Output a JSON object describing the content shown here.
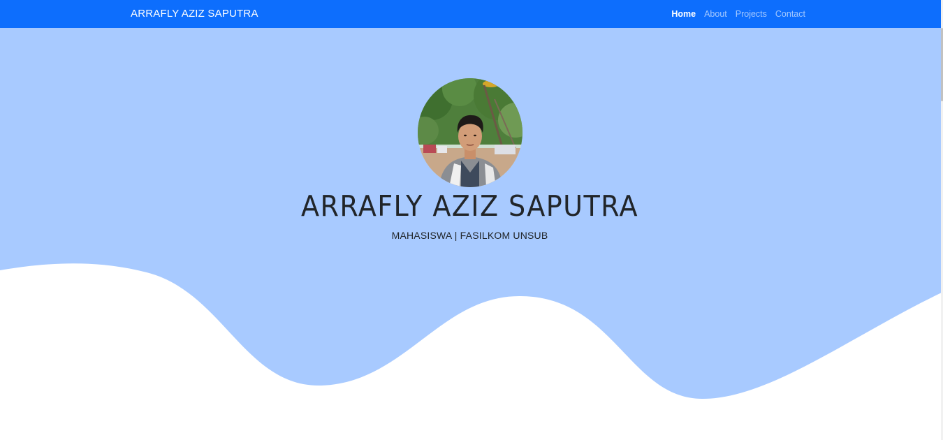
{
  "navbar": {
    "brand": "ARRAFLY AZIZ SAPUTRA",
    "links": [
      {
        "label": "Home",
        "active": true
      },
      {
        "label": "About",
        "active": false
      },
      {
        "label": "Projects",
        "active": false
      },
      {
        "label": "Contact",
        "active": false
      }
    ]
  },
  "hero": {
    "title": "ARRAFLY AZIZ SAPUTRA",
    "subtitle": "MAHASISWA | FASILKOM UNSUB"
  },
  "colors": {
    "navbar_bg": "#0d6efd",
    "hero_bg": "#a8caff",
    "wave_fill": "#ffffff",
    "text_dark": "#212529"
  },
  "icons": {
    "profile_photo": "profile-photo"
  }
}
